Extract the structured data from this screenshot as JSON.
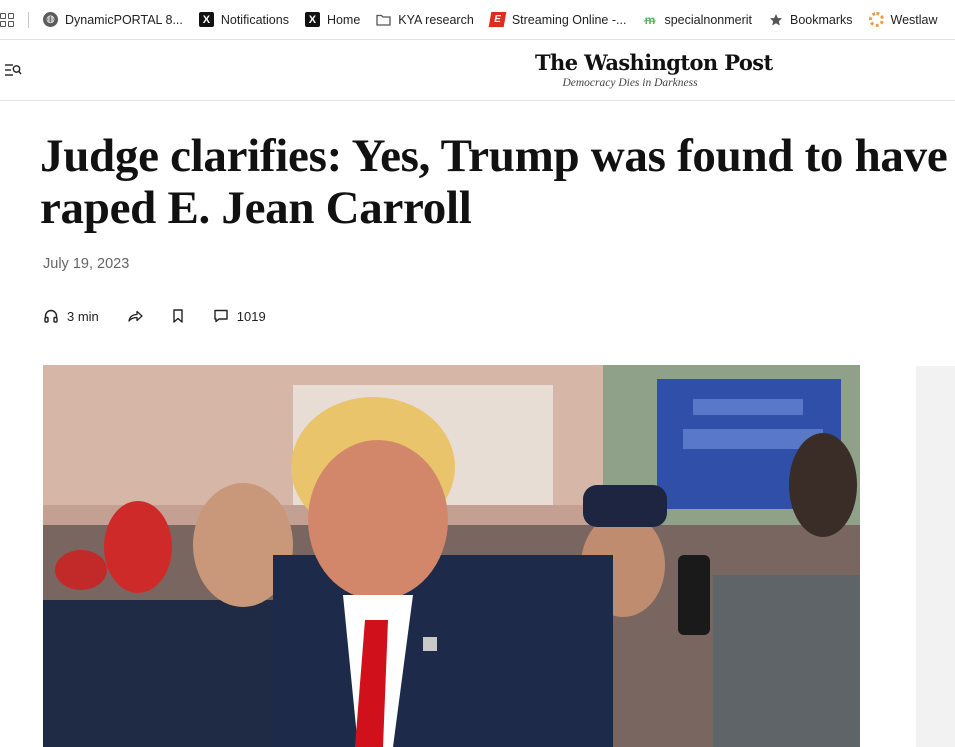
{
  "bookmarks": [
    {
      "label": "DynamicPORTAL 8...",
      "icon": "globe-icon"
    },
    {
      "label": "Notifications",
      "icon": "x-logo-icon"
    },
    {
      "label": "Home",
      "icon": "x-logo-icon"
    },
    {
      "label": "KYA research",
      "icon": "folder-icon"
    },
    {
      "label": "Streaming Online -...",
      "icon": "espn-icon"
    },
    {
      "label": "specialnonmerit",
      "icon": "specialnonmerit-icon"
    },
    {
      "label": "Bookmarks",
      "icon": "star-icon"
    },
    {
      "label": "Westlaw",
      "icon": "westlaw-icon"
    }
  ],
  "header": {
    "masthead": "The Washington Post",
    "tagline": "Democracy Dies in Darkness"
  },
  "article": {
    "headline": "Judge clarifies: Yes, Trump was found to have raped E. Jean Carroll",
    "date": "July 19, 2023",
    "listen_label": "3 min",
    "comment_count": "1019"
  },
  "colors": {
    "text": "#111111",
    "muted": "#666666",
    "divider": "#e6e6e6"
  }
}
